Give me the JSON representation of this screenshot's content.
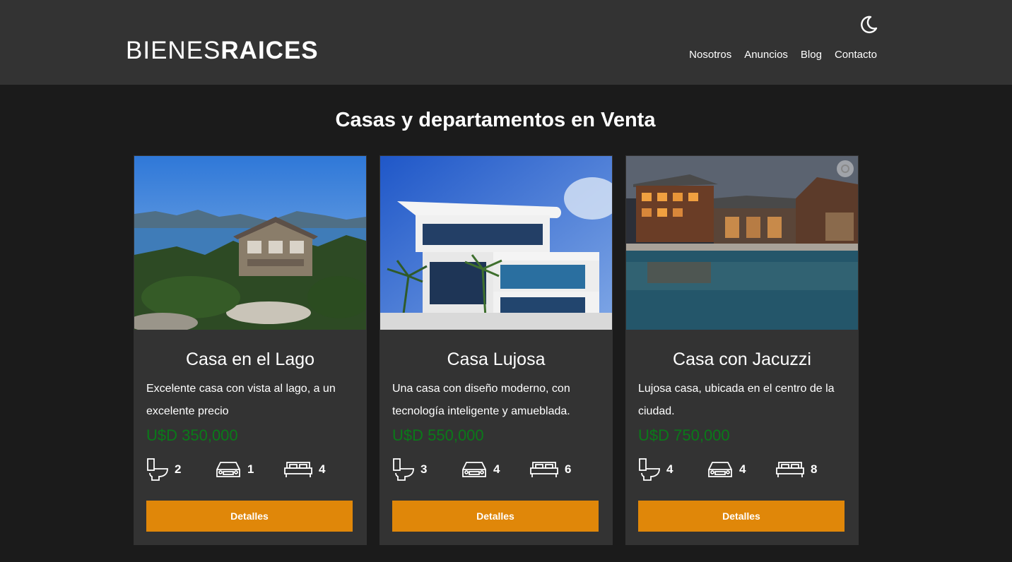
{
  "header": {
    "logo_light": "BIENES",
    "logo_bold": "RAICES",
    "nav": [
      "Nosotros",
      "Anuncios",
      "Blog",
      "Contacto"
    ],
    "theme_icon": "moon-icon"
  },
  "main": {
    "title": "Casas y departamentos en Venta",
    "cards": [
      {
        "title": "Casa en el Lago",
        "description": "Excelente casa con vista al lago, a un excelente precio",
        "price": "U$D 350,000",
        "bathrooms": "2",
        "parking": "1",
        "bedrooms": "4",
        "button": "Detalles"
      },
      {
        "title": "Casa Lujosa",
        "description": "Una casa con diseño moderno, con tecnología inteligente y amueblada.",
        "price": "U$D 550,000",
        "bathrooms": "3",
        "parking": "4",
        "bedrooms": "6",
        "button": "Detalles"
      },
      {
        "title": "Casa con Jacuzzi",
        "description": "Lujosa casa, ubicada en el centro de la ciudad.",
        "price": "U$D 750,000",
        "bathrooms": "4",
        "parking": "4",
        "bedrooms": "8",
        "button": "Detalles"
      }
    ]
  },
  "colors": {
    "header_bg": "#333333",
    "page_bg": "#1b1b1b",
    "accent": "#e08709",
    "price": "#0a7a19"
  }
}
